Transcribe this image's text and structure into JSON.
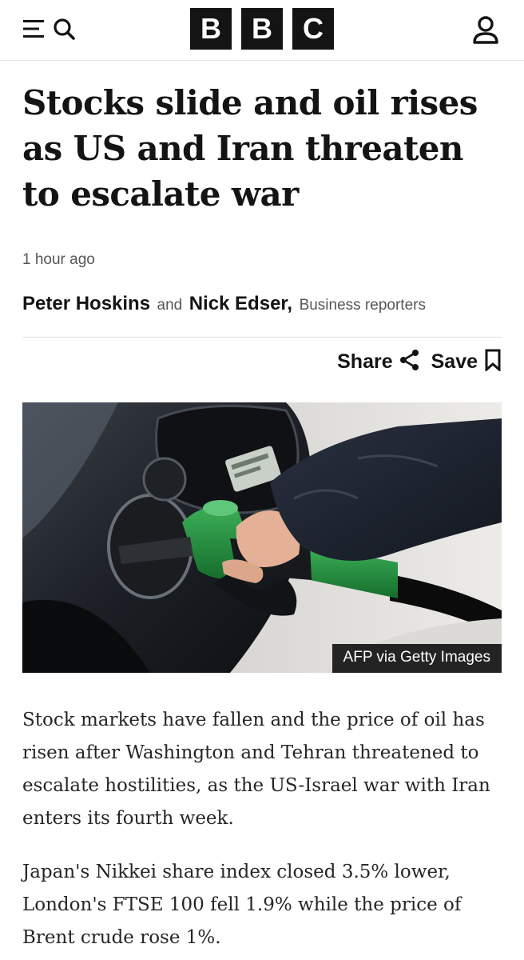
{
  "header": {
    "logo_letters": [
      "B",
      "B",
      "C"
    ],
    "menu_icon": "menu-icon",
    "search_icon": "search-icon",
    "account_icon": "account-icon"
  },
  "article": {
    "headline": "Stocks slide and oil rises as US and Iran threaten to escalate war",
    "timestamp": "1 hour ago",
    "byline": {
      "author1": "Peter Hoskins",
      "conjunction": "and",
      "author2": "Nick Edser,",
      "role": "Business reporters"
    },
    "share_label": "Share",
    "save_label": "Save",
    "image": {
      "credit": "AFP via Getty Images",
      "icon": "fuel-pump-photo"
    },
    "paragraphs": [
      "Stock markets have fallen and the price of oil has risen after Washington and Tehran threatened to escalate hostilities, as the US-Israel war with Iran enters its fourth week.",
      "Japan's Nikkei share index closed 3.5% lower, London's FTSE 100 fell 1.9% while the price of Brent crude rose 1%."
    ]
  },
  "colors": {
    "brand": "#141414",
    "text_secondary": "#545658",
    "nozzle_green": "#1f8a3a"
  }
}
